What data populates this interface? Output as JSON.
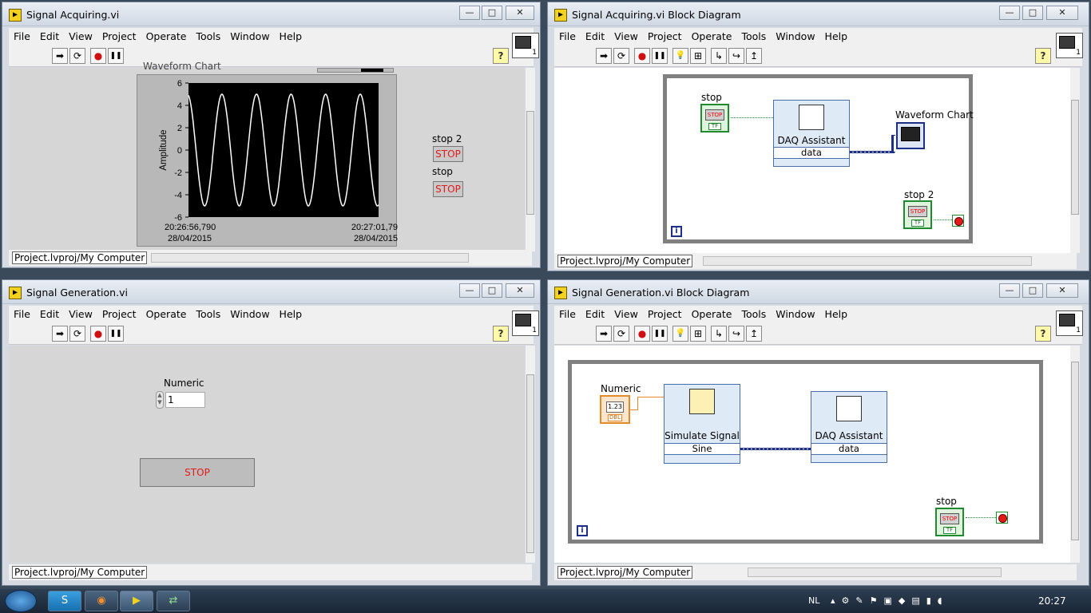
{
  "menu": [
    "File",
    "Edit",
    "View",
    "Project",
    "Operate",
    "Tools",
    "Window",
    "Help"
  ],
  "project_path": "Project.lvproj/My Computer",
  "window_controls": {
    "minimize": "—",
    "maximize": "□",
    "close": "✕"
  },
  "toolbar_icons": {
    "run": "➡",
    "run_continuous": "⟳",
    "abort": "●",
    "pause": "❚❚",
    "help": "?",
    "highlight": "💡",
    "step_into": "↳",
    "step_over": "↪",
    "step_out": "↥",
    "retain": "⊞"
  },
  "acq_front": {
    "title": "Signal Acquiring.vi",
    "chart": {
      "label": "Waveform Chart",
      "chart_data": {
        "type": "line",
        "title": "Waveform Chart",
        "ylabel": "Amplitude",
        "xlabel": "",
        "ylim": [
          -6,
          6
        ],
        "yticks": [
          "6",
          "4",
          "2",
          "0",
          "-2",
          "-4",
          "-6"
        ],
        "x_start": {
          "time": "20:26:56,790",
          "date": "28/04/2015"
        },
        "x_end": {
          "time": "20:27:01,79",
          "date": "28/04/2015"
        },
        "series": [
          {
            "function": "sine",
            "amplitude": 5,
            "cycles": 5.5,
            "color": "#ffffff"
          }
        ],
        "grid": false,
        "background": "#000000"
      }
    },
    "stop2_label": "stop 2",
    "stop2_text": "STOP",
    "stop_label": "stop",
    "stop_text": "STOP"
  },
  "acq_block": {
    "title": "Signal Acquiring.vi Block Diagram",
    "stop_label": "stop",
    "daq_name": "DAQ Assistant",
    "daq_terminal": "data",
    "chart_label": "Waveform Chart",
    "stop2_label": "stop 2",
    "iter": "i",
    "stop_img": "STOP",
    "tf": "TF"
  },
  "gen_front": {
    "title": "Signal Generation.vi",
    "numeric_label": "Numeric",
    "numeric_value": "1",
    "stop_text": "STOP"
  },
  "gen_block": {
    "title": "Signal Generation.vi Block Diagram",
    "numeric_label": "Numeric",
    "numeric_type": "DBL",
    "numeric_glyph": "1.23",
    "sim_name": "Simulate Signal",
    "sim_terminal": "Sine",
    "daq_name": "DAQ Assistant",
    "daq_terminal": "data",
    "stop_label": "stop",
    "iter": "i",
    "stop_img": "STOP",
    "tf": "TF"
  },
  "taskbar": {
    "language": "NL",
    "clock": "20:27",
    "skype": "S",
    "firefox": "◉",
    "labview": "▶",
    "other": "⇄"
  }
}
